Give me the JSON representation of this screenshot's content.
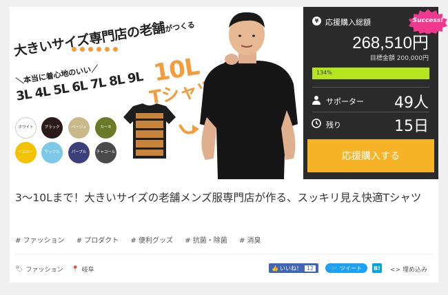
{
  "hero": {
    "catch_big": "大きいサイズ専門店の老舗",
    "catch_small": "がつくる",
    "subcopy": "＼本当に着心地のいい／",
    "sizes": [
      "3L",
      "4L",
      "5L",
      "6L",
      "7L",
      "8L",
      "9L"
    ],
    "ten_l": "10L",
    "tshirt_word": "Tシャツ",
    "colors": [
      {
        "name": "ホワイト",
        "hex": "#ffffff"
      },
      {
        "name": "ブラック",
        "hex": "#2a1a1a"
      },
      {
        "name": "ベージュ",
        "hex": "#c9b98a"
      },
      {
        "name": "カーキ",
        "hex": "#6b7a28"
      },
      {
        "name": "イエロー",
        "hex": "#f2c200"
      },
      {
        "name": "サックス",
        "hex": "#7cc8e6"
      },
      {
        "name": "パープル",
        "hex": "#3b3f7a"
      },
      {
        "name": "チャコール",
        "hex": "#4a4a4a"
      }
    ]
  },
  "panel": {
    "funding_label": "応援購入総額",
    "amount": "268,510円",
    "target": "目標金額 200,000円",
    "progress_label": "134%",
    "progress_fraction": 1.0,
    "supporters_label": "サポーター",
    "supporters_value": "49人",
    "remaining_label": "残り",
    "remaining_value": "15日",
    "cta": "応援購入する",
    "badge": "Success!"
  },
  "project": {
    "title": "3〜10Lまで！大きいサイズの老舗メンズ服専門店が作る、スッキリ見え快適Tシャツ",
    "tags": [
      "# ファッション",
      "# プロダクト",
      "# 便利グッズ",
      "# 抗菌・除菌",
      "# 消臭"
    ],
    "category": "ファッション",
    "location": "岐阜",
    "like_label": "いいね！",
    "like_count": "12",
    "tweet_label": "ツイート",
    "hatena_label": "B!",
    "embed_label": "埋め込み"
  },
  "colors": {
    "accent": "#f5b325",
    "panel_bg": "#2b2b2b",
    "progress": "#b5e61d",
    "badge": "#f0388f"
  }
}
